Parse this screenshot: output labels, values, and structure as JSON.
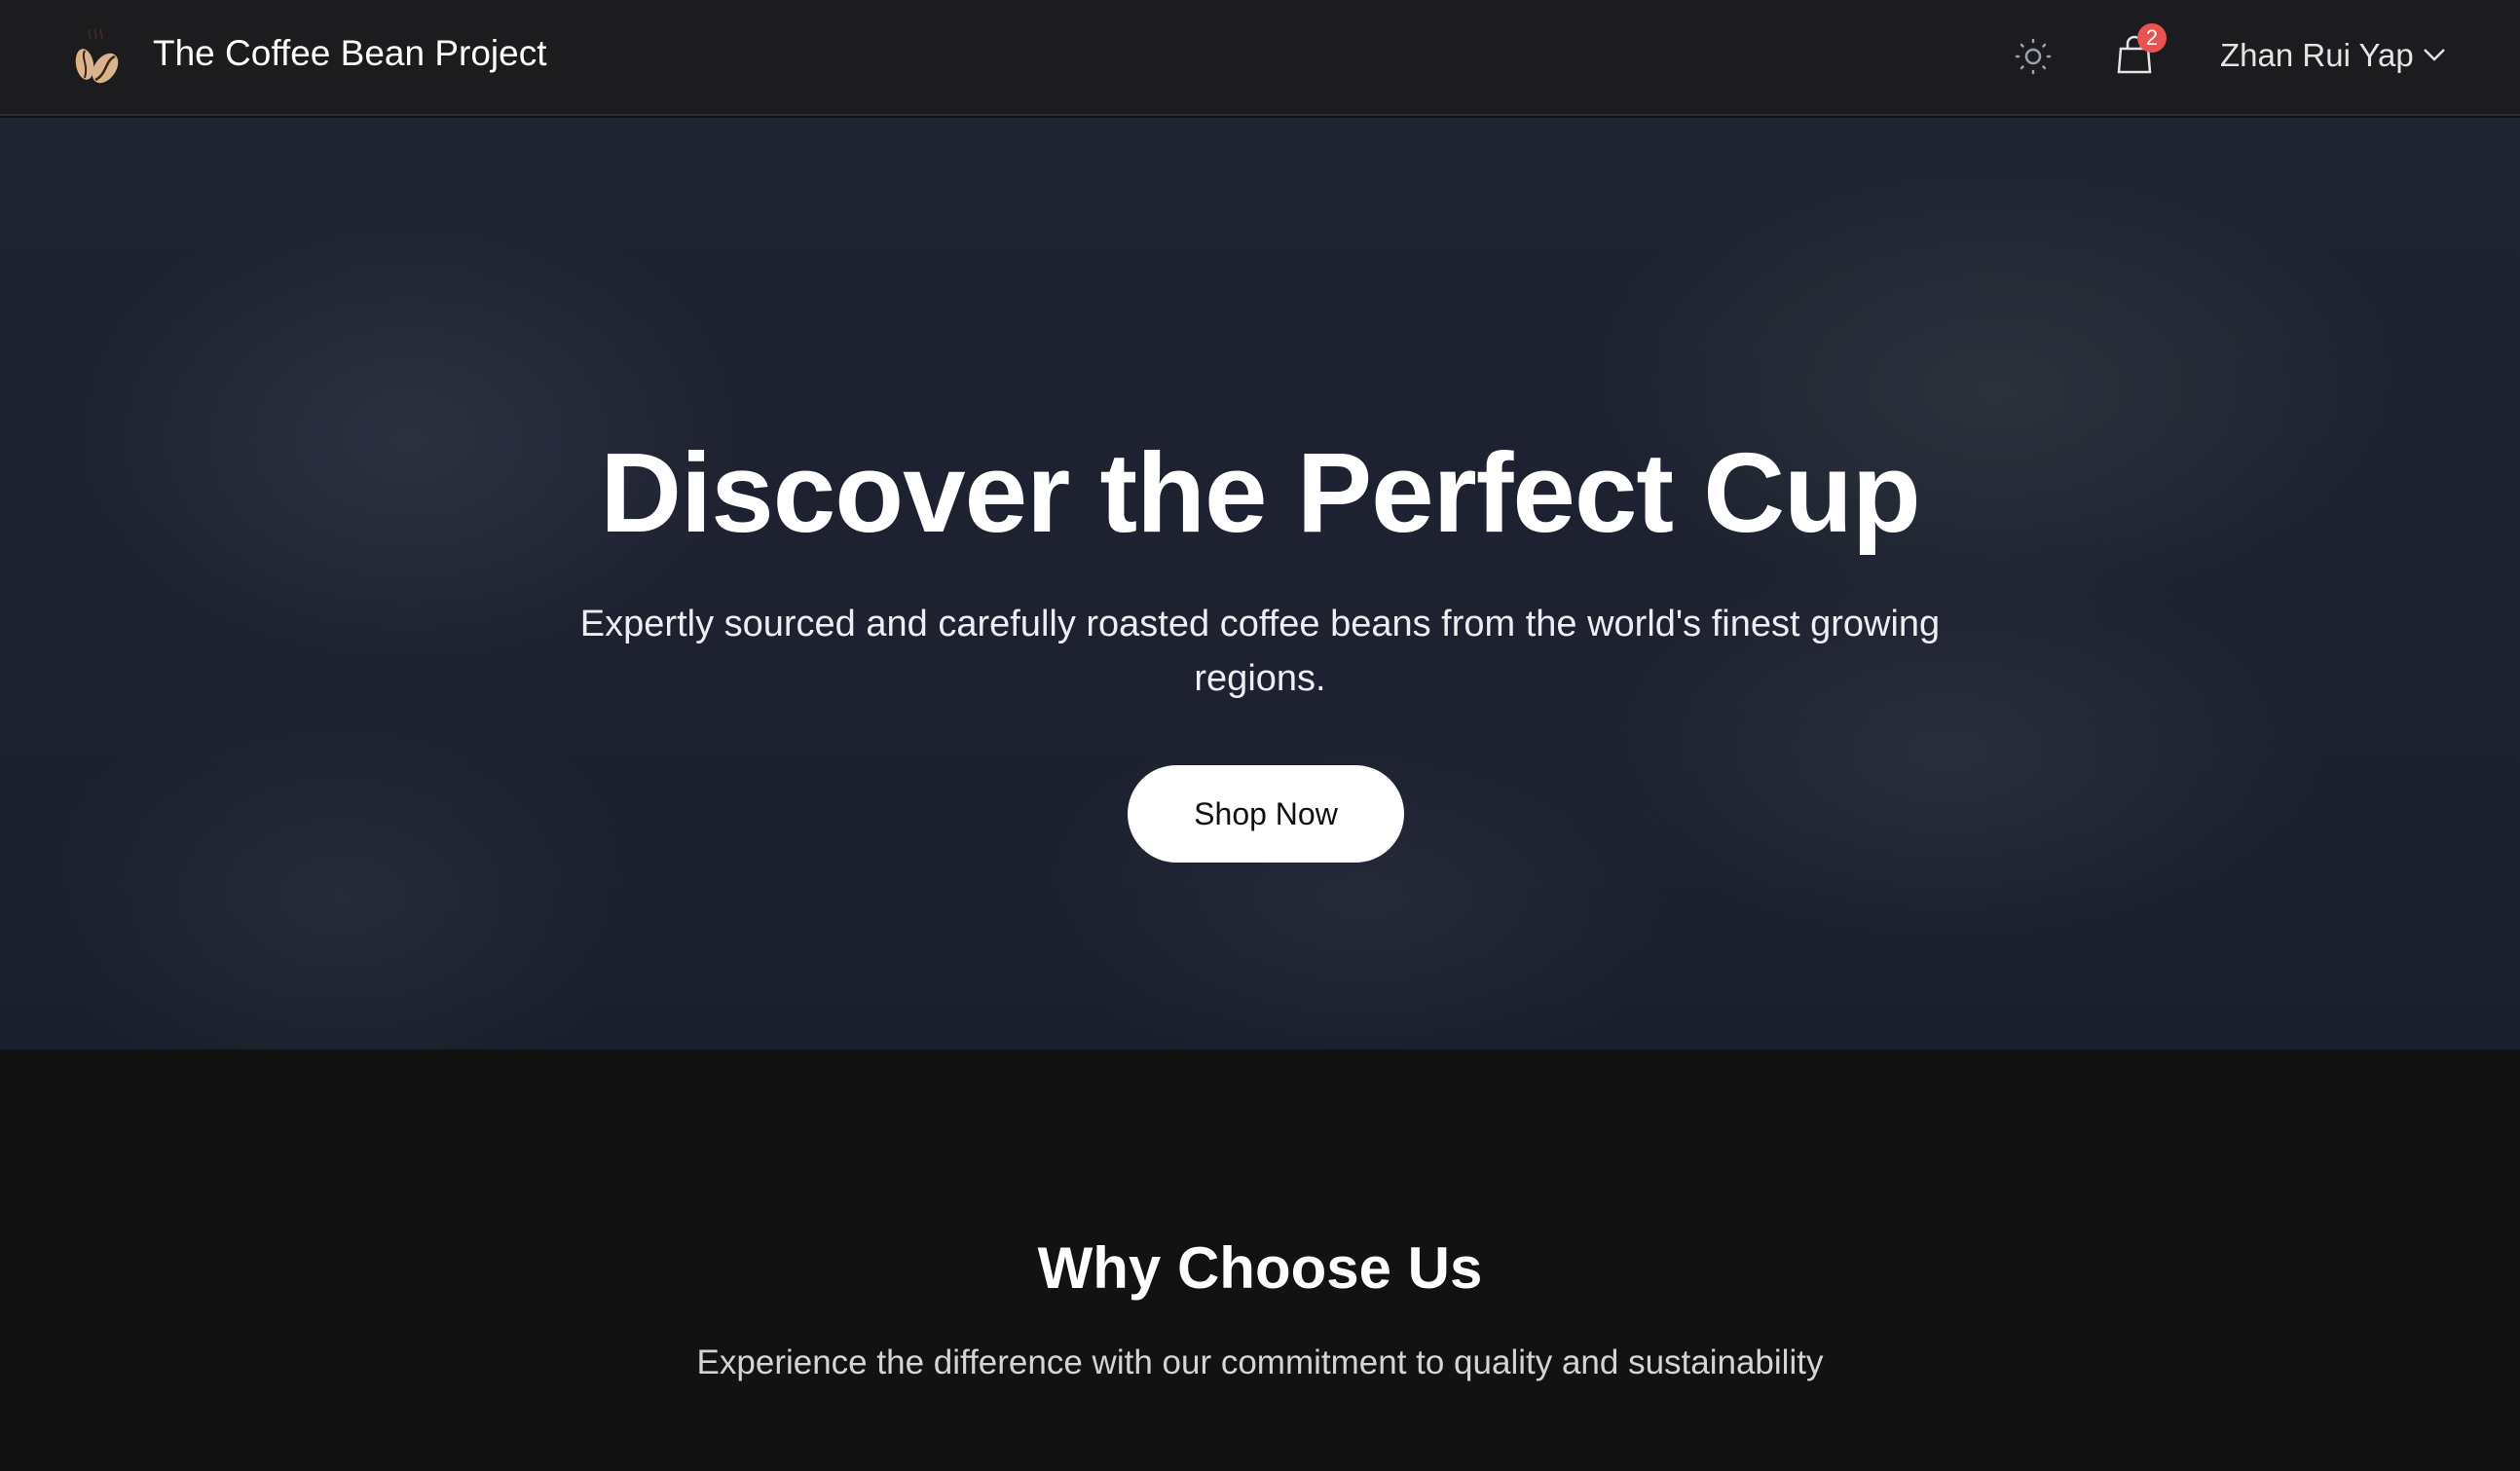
{
  "header": {
    "brand": "The Coffee Bean Project",
    "cart_count": "2",
    "user_name": "Zhan Rui Yap",
    "icons": [
      "coffee-bean-logo",
      "sun-icon",
      "shopping-bag-icon",
      "chevron-down-icon"
    ]
  },
  "hero": {
    "title": "Discover the Perfect Cup",
    "subtitle": "Expertly sourced and carefully roasted coffee beans from the world's finest growing regions.",
    "cta": "Shop Now"
  },
  "features": {
    "title": "Why Choose Us",
    "subtitle": "Experience the difference with our commitment to quality and sustainability"
  },
  "colors": {
    "header_bg": "#1c1c1e",
    "page_bg": "#121212",
    "badge": "#e8534f",
    "logo": "#d9b38c"
  }
}
